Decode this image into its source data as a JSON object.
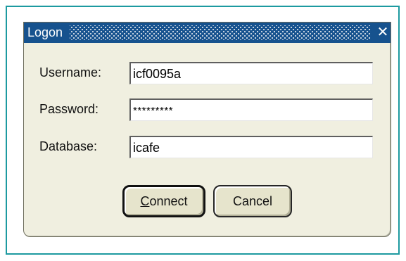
{
  "dialog": {
    "title": "Logon",
    "close_glyph": "✕",
    "fields": {
      "username": {
        "label": "Username:",
        "value": "icf0095a"
      },
      "password": {
        "label": "Password:",
        "value": "*********"
      },
      "database": {
        "label": "Database:",
        "value": "icafe"
      }
    },
    "buttons": {
      "connect": {
        "mnemonic": "C",
        "rest": "onnect"
      },
      "cancel": {
        "label": "Cancel"
      }
    }
  },
  "colors": {
    "titlebar": "#16528e",
    "dialog_background": "#f0efe0",
    "frame_border": "#1d9aa0",
    "button_face": "#e6e4cc"
  },
  "icons": {
    "close": "close-icon",
    "title_grip": "grip-pattern"
  }
}
